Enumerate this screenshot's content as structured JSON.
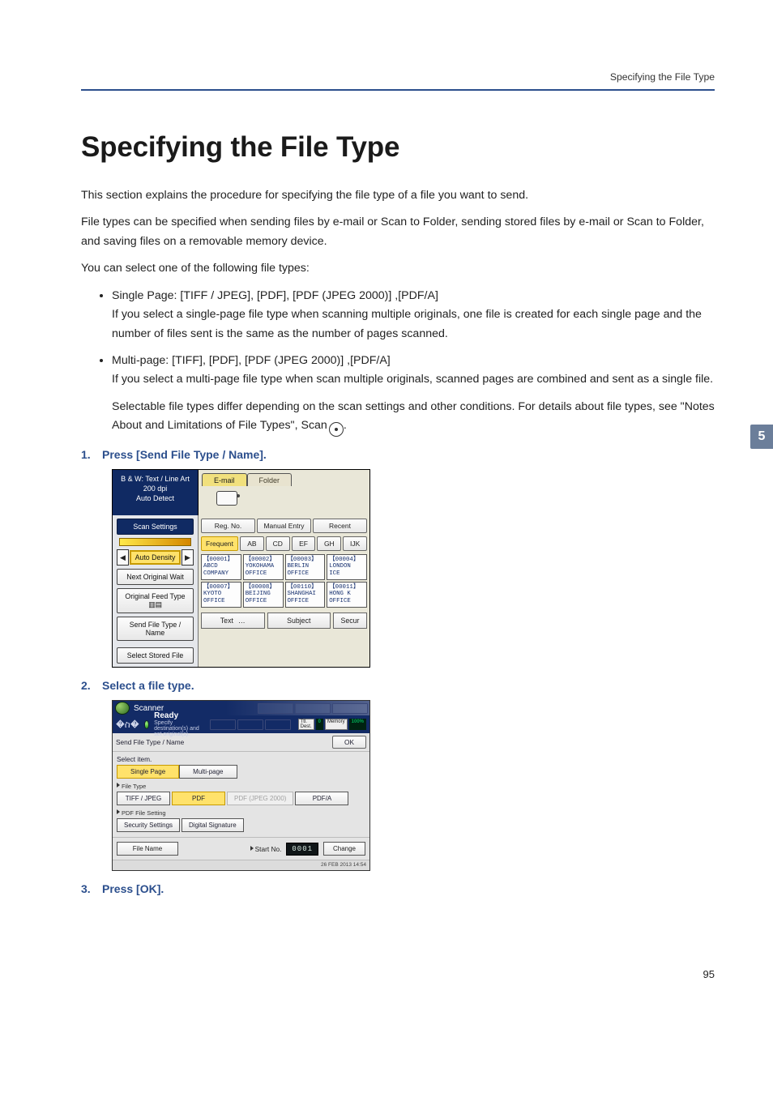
{
  "runningHead": "Specifying the File Type",
  "h1": "Specifying the File Type",
  "p1": "This section explains the procedure for specifying the file type of a file you want to send.",
  "p2": "File types can be specified when sending files by e-mail or Scan to Folder, sending stored files by e-mail or Scan to Folder, and saving files on a removable memory device.",
  "p3": "You can select one of the following file types:",
  "bullets": {
    "b1": "Single Page: [TIFF / JPEG], [PDF], [PDF (JPEG 2000)] ,[PDF/A]",
    "b1sub": "If you select a single-page file type when scanning multiple originals, one file is created for each single page and the number of files sent is the same as the number of pages scanned.",
    "b2": "Multi-page: [TIFF], [PDF], [PDF (JPEG 2000)] ,[PDF/A]",
    "b2sub1": "If you select a multi-page file type when scan multiple originals, scanned pages are combined and sent as a single file.",
    "b2sub2a": "Selectable file types differ depending on the scan settings and other conditions. For details about file types, see \"Notes About and Limitations of File Types\", Scan",
    "b2sub2b": "."
  },
  "sideTab": "5",
  "steps": {
    "s1n": "1.",
    "s1": "Press [Send File Type / Name].",
    "s2n": "2.",
    "s2": "Select a file type.",
    "s3n": "3.",
    "s3": "Press [OK]."
  },
  "shot1": {
    "leftTop1": "B & W: Text / Line Art",
    "leftTop2": "200 dpi",
    "leftTop3": "Auto Detect",
    "tabEmail": "E-mail",
    "tabFolder": "Folder",
    "scanSettings": "Scan Settings",
    "autoDensity": "Auto Density",
    "arrowL": "◀",
    "arrowR": "▶",
    "regNo": "Reg. No.",
    "manual": "Manual Entry",
    "recent": "Recent",
    "freq": "Frequent",
    "ab": "AB",
    "cd": "CD",
    "ef": "EF",
    "gh": "GH",
    "ijk": "IJK",
    "nextOrig": "Next Original Wait",
    "origFeed": "Original Feed Type ",
    "origFeedIcons": "▥▤",
    "sendFile": "Send File Type / Name",
    "selectStored": "Select Stored File",
    "d1": "【00001】\nABCD COMPANY",
    "d2": "【00002】\nYOKOHAMA OFFICE",
    "d3": "【00003】\nBERLIN OFFICE",
    "d4": "【00004】\nLONDON\nICE",
    "d5": "【00007】\nKYOTO OFFICE",
    "d6": "【00008】\nBEIJING OFFICE",
    "d7": "【00110】\nSHANGHAI OFFICE",
    "d8": "【00011】\nHONG K\nOFFICE",
    "textBtn": "Text",
    "textDots": "…",
    "subjectBtn": "Subject",
    "secBtn": "Secur"
  },
  "shot2": {
    "title": "Scanner",
    "ready": "Ready",
    "subtext": "Specify destination(s) and set original(s).",
    "memDest": "Ttl. Dest.",
    "memDestV": "0",
    "memLbl": "Memory",
    "memVal": "100%",
    "bar": "Send File Type / Name",
    "ok": "OK",
    "selectItem": "Select item.",
    "single": "Single Page",
    "multi": "Multi-page",
    "ftype": "File Type",
    "o1": "TIFF / JPEG",
    "o2": "PDF",
    "o3": "PDF (JPEG 2000)",
    "o4": "PDF/A",
    "pdfset": "PDF File Setting",
    "sec": "Security Settings",
    "sig": "Digital Signature",
    "fname": "File Name",
    "startno": "Start No.",
    "digits": "0001",
    "change": "Change",
    "stamp": "26 FEB  2013\n14:54"
  },
  "pageNumber": "95"
}
